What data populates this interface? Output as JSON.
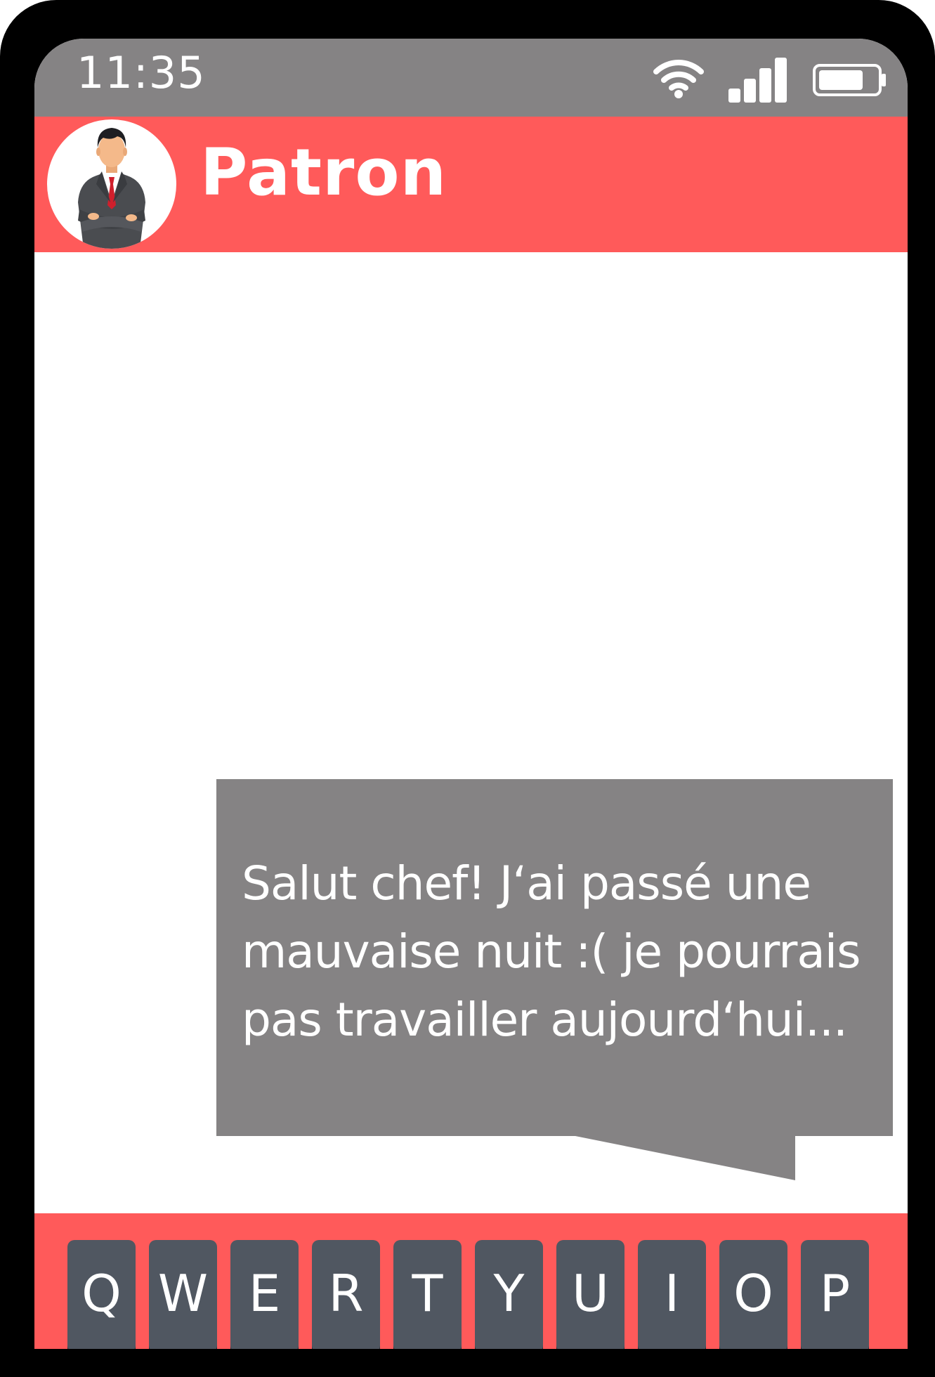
{
  "status_bar": {
    "time": "11:35",
    "icons": [
      "wifi-icon",
      "signal-icon",
      "battery-icon"
    ]
  },
  "header": {
    "contact_name": "Patron",
    "avatar": "businessman-avatar"
  },
  "message": {
    "text": "Salut chef! J‘ai passé une mauvaise nuit :( je pourrais pas travailler aujourd‘hui..."
  },
  "keyboard": {
    "keys": [
      "Q",
      "W",
      "E",
      "R",
      "T",
      "Y",
      "U",
      "I",
      "O",
      "P"
    ]
  },
  "colors": {
    "accent": "#ff5a5a",
    "status_bar": "#858384",
    "bubble": "#858384",
    "key": "#505761",
    "frame": "#000000"
  }
}
